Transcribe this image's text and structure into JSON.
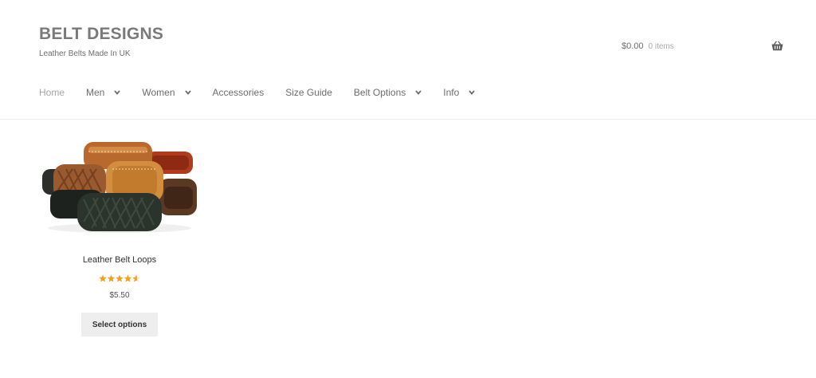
{
  "site": {
    "title": "BELT DESIGNS",
    "tagline": "Leather Belts Made In UK"
  },
  "cart": {
    "amount": "$0.00",
    "count": "0 items",
    "icon": "basket-icon"
  },
  "nav": {
    "items": [
      {
        "label": "Home",
        "current": true,
        "dropdown": false
      },
      {
        "label": "Men",
        "dropdown": true
      },
      {
        "label": "Women",
        "dropdown": true
      },
      {
        "label": "Accessories",
        "dropdown": false
      },
      {
        "label": "Size Guide",
        "dropdown": false
      },
      {
        "label": "Belt Options",
        "dropdown": true
      },
      {
        "label": "Info",
        "dropdown": true
      }
    ]
  },
  "product": {
    "title": "Leather Belt Loops",
    "rating": 4.6,
    "rating_max": 5,
    "price": "$5.50",
    "button_label": "Select options"
  },
  "colors": {
    "star": "#f2a11c",
    "button_bg": "#eeeeee"
  }
}
